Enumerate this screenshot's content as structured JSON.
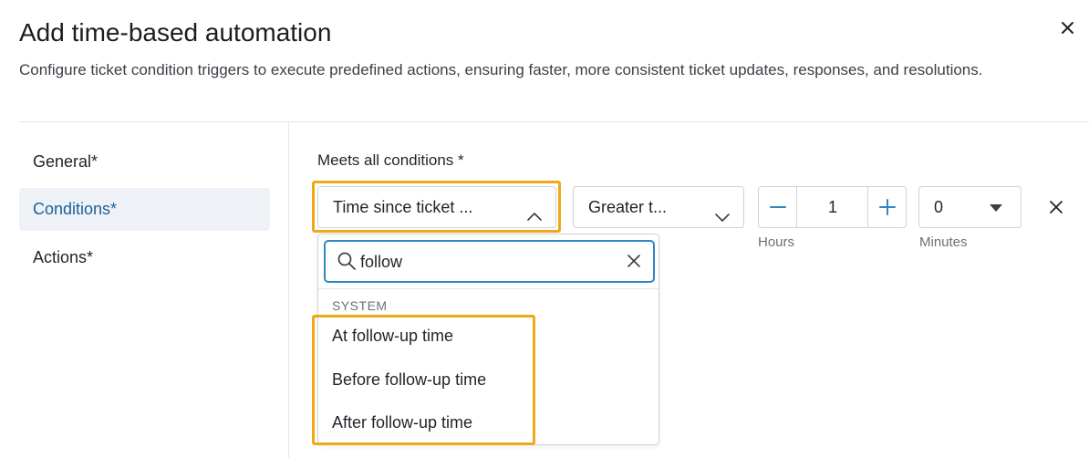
{
  "dialog": {
    "title": "Add time-based automation",
    "description": "Configure ticket condition triggers to execute predefined actions, ensuring faster, more consistent ticket updates, responses, and resolutions.",
    "close_icon": "close-icon"
  },
  "sidebar": {
    "items": [
      {
        "label": "General*",
        "active": false
      },
      {
        "label": "Conditions*",
        "active": true
      },
      {
        "label": "Actions*",
        "active": false
      }
    ]
  },
  "conditions": {
    "heading": "Meets all conditions *",
    "field_select": {
      "value": "Time since ticket ...",
      "expanded": true
    },
    "operator_select": {
      "value": "Greater t..."
    },
    "hours": {
      "value": "1",
      "label": "Hours"
    },
    "minutes": {
      "value": "0",
      "label": "Minutes"
    },
    "remove_icon": "close-icon"
  },
  "dropdown": {
    "search": {
      "value": "follow",
      "placeholder": ""
    },
    "group_label": "SYSTEM",
    "options": [
      "At follow-up time",
      "Before follow-up time",
      "After follow-up time"
    ]
  },
  "colors": {
    "accent": "#1b5f9e",
    "focus_border": "#2f86c4",
    "highlight": "#f0a814",
    "active_nav_bg": "#eef2f7"
  }
}
